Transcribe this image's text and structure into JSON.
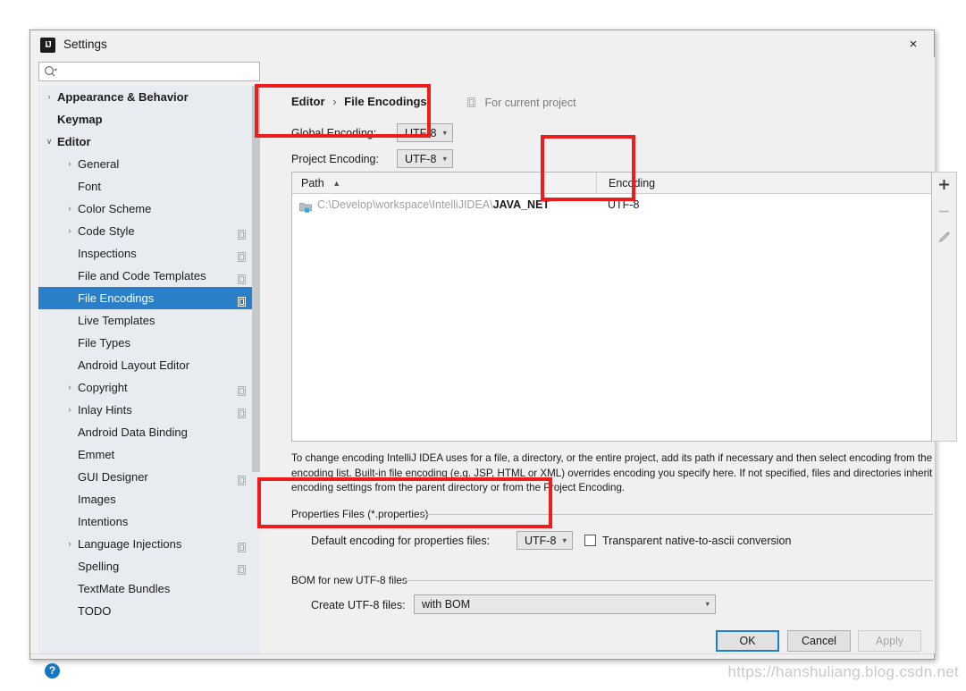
{
  "window": {
    "title": "Settings",
    "app_icon_text": "IJ",
    "close_icon": "×"
  },
  "search": {
    "value": "",
    "placeholder": "",
    "icon": "search-icon"
  },
  "sidebar": {
    "items": [
      {
        "label": "Appearance & Behavior",
        "level": 0,
        "arrow": "›",
        "bold": true,
        "selected": false,
        "badge": false
      },
      {
        "label": "Keymap",
        "level": 0,
        "arrow": "",
        "bold": true,
        "selected": false,
        "badge": false
      },
      {
        "label": "Editor",
        "level": 0,
        "arrow": "⌄",
        "bold": true,
        "selected": false,
        "badge": false
      },
      {
        "label": "General",
        "level": 1,
        "arrow": "›",
        "bold": false,
        "selected": false,
        "badge": false
      },
      {
        "label": "Font",
        "level": 1,
        "arrow": "",
        "bold": false,
        "selected": false,
        "badge": false
      },
      {
        "label": "Color Scheme",
        "level": 1,
        "arrow": "›",
        "bold": false,
        "selected": false,
        "badge": false
      },
      {
        "label": "Code Style",
        "level": 1,
        "arrow": "›",
        "bold": false,
        "selected": false,
        "badge": true
      },
      {
        "label": "Inspections",
        "level": 1,
        "arrow": "",
        "bold": false,
        "selected": false,
        "badge": true
      },
      {
        "label": "File and Code Templates",
        "level": 1,
        "arrow": "",
        "bold": false,
        "selected": false,
        "badge": true
      },
      {
        "label": "File Encodings",
        "level": 1,
        "arrow": "",
        "bold": false,
        "selected": true,
        "badge": true
      },
      {
        "label": "Live Templates",
        "level": 1,
        "arrow": "",
        "bold": false,
        "selected": false,
        "badge": false
      },
      {
        "label": "File Types",
        "level": 1,
        "arrow": "",
        "bold": false,
        "selected": false,
        "badge": false
      },
      {
        "label": "Android Layout Editor",
        "level": 1,
        "arrow": "",
        "bold": false,
        "selected": false,
        "badge": false
      },
      {
        "label": "Copyright",
        "level": 1,
        "arrow": "›",
        "bold": false,
        "selected": false,
        "badge": true
      },
      {
        "label": "Inlay Hints",
        "level": 1,
        "arrow": "›",
        "bold": false,
        "selected": false,
        "badge": true
      },
      {
        "label": "Android Data Binding",
        "level": 1,
        "arrow": "",
        "bold": false,
        "selected": false,
        "badge": false
      },
      {
        "label": "Emmet",
        "level": 1,
        "arrow": "",
        "bold": false,
        "selected": false,
        "badge": false
      },
      {
        "label": "GUI Designer",
        "level": 1,
        "arrow": "",
        "bold": false,
        "selected": false,
        "badge": true
      },
      {
        "label": "Images",
        "level": 1,
        "arrow": "",
        "bold": false,
        "selected": false,
        "badge": false
      },
      {
        "label": "Intentions",
        "level": 1,
        "arrow": "",
        "bold": false,
        "selected": false,
        "badge": false
      },
      {
        "label": "Language Injections",
        "level": 1,
        "arrow": "›",
        "bold": false,
        "selected": false,
        "badge": true
      },
      {
        "label": "Spelling",
        "level": 1,
        "arrow": "",
        "bold": false,
        "selected": false,
        "badge": true
      },
      {
        "label": "TextMate Bundles",
        "level": 1,
        "arrow": "",
        "bold": false,
        "selected": false,
        "badge": false
      },
      {
        "label": "TODO",
        "level": 1,
        "arrow": "",
        "bold": false,
        "selected": false,
        "badge": false
      }
    ]
  },
  "main": {
    "breadcrumb": {
      "parent": "Editor",
      "separator": "›",
      "current": "File Encodings"
    },
    "for_current_project": "For current project",
    "global_encoding": {
      "label": "Global Encoding:",
      "value": "UTF-8"
    },
    "project_encoding": {
      "label": "Project Encoding:",
      "value": "UTF-8"
    },
    "table": {
      "columns": [
        "Path",
        "Encoding"
      ],
      "sort_arrow": "▲",
      "rows": [
        {
          "path_prefix": "C:\\Develop\\workspace\\IntelliJIDEA\\",
          "path_name": "JAVA_NET",
          "encoding": "UTF-8"
        }
      ]
    },
    "table_toolbar": {
      "add": "+",
      "remove": "−",
      "edit": "pencil"
    },
    "description": "To change encoding IntelliJ IDEA uses for a file, a directory, or the entire project, add its path if necessary and then select encoding from the encoding list. Built-in file encoding (e.g. JSP, HTML or XML) overrides encoding you specify here. If not specified, files and directories inherit encoding settings from the parent directory or from the Project Encoding.",
    "properties_group": {
      "title": "Properties Files (*.properties)",
      "default_encoding_label": "Default encoding for properties files:",
      "default_encoding_value": "UTF-8",
      "transparent_label": "Transparent native-to-ascii conversion",
      "transparent_checked": false
    },
    "bom_group": {
      "title": "BOM for new UTF-8 files",
      "create_label": "Create UTF-8 files:",
      "create_value": "with BOM"
    }
  },
  "footer": {
    "help": "?",
    "ok": "OK",
    "cancel": "Cancel",
    "apply": "Apply"
  },
  "watermark": "https://hanshuliang.blog.csdn.net",
  "colors": {
    "selection_blue": "#2a7fc9",
    "annotation_red": "#ef1c1c",
    "focus_blue": "#1a7fd4",
    "help_blue": "#1577c4"
  }
}
